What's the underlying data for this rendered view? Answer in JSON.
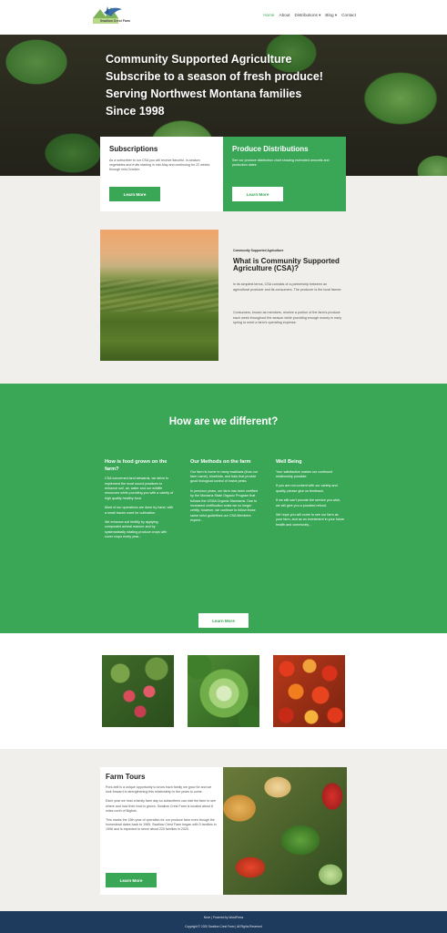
{
  "header": {
    "logo_text": "Swallow Crest Farm",
    "nav": [
      "Home",
      "About",
      "Distributions ▾",
      "Blog ▾",
      "Contact"
    ]
  },
  "hero": {
    "lines": [
      "Community Supported Agriculture",
      "Subscribe to a season of fresh produce!",
      "Serving Northwest Montana families",
      "Since 1998"
    ]
  },
  "cards": {
    "subscriptions": {
      "title": "Subscriptions",
      "text": "As a subscriber to our CSA you will receive flavorful, in-season vegetables and fruits starting in mid-May and continuing for 22 weeks through mid-October.",
      "button": "Learn More"
    },
    "distributions": {
      "title": "Produce Distributions",
      "text": "See our produce distribution chart showing estimated amounts and production dates",
      "button": "Learn More"
    }
  },
  "csa": {
    "small_label": "Community Supported Agriculture",
    "title": "What is Community Supported Agriculture (CSA)?",
    "p1": "In its simplest terms, CSA consists of a partnership between an agricultural producer and its consumers. The producer is the local farmer.",
    "p2": "Consumers, known as members, receive a portion of the farm's produce each week throughout the season while providing enough money in early spring to meet a farm's operating expense."
  },
  "different": {
    "title": "How are we different?",
    "col1": {
      "title": "How is food grown on the farm?",
      "p1": "CSA concerned land stewards, we strive to implement the most sound practices to enhance soil, air, water and our wildlife resources while providing you with a variety of high quality healthy food.",
      "p2": "Most of our operations are done by hand, with a small tractor used for cultivation.",
      "p3": "We enhance soil fertility by applying composted animal manure and by systematically rotating produce crops with cover crops every year..."
    },
    "col2": {
      "title": "Our Methods on the farm",
      "p1": "Our farm is home to many swallows (thus our farm name), bluebirds, and bats that provide good biological control of insect pests.",
      "p2": "In previous years, our farm has been certified by the Montana State Organic Program that follows the USDA Organic Standards. Due to increased certification costs we no longer certify, however, we continue to follow those same strict guidelines our CSA Members expect..."
    },
    "col3": {
      "title": "Well Being",
      "p1": "Your satisfaction makes our continued relationship possible.",
      "p2": "If you are not content with our variety and quality, please give us feedback.",
      "p3": "If we still can't provide the service you wish, we will give you a prorated refund.",
      "p4": "We hope you will come to see our farm as your farm, and as an investment in your future health and community..."
    },
    "button": "Learn More"
  },
  "tours": {
    "title": "Farm Tours",
    "p1": "Pork-belt is a unique opportunity to know each family we grow for and we look forward to strengthening this relationship in the years to come.",
    "p2": "Each year we host a family farm day so subscribers can visit the farm to see where and how their food is grown. Swallow Crest Farm is located about 6 miles north of Bigfork.",
    "p3": "This marks the 15th year of operation for our produce farm even though the homestead dates back to 1985. Swallow Crest Farm began with 5 families in 1998 and is expected to serve about 220 families in 2020.",
    "button": "Learn More"
  },
  "footer": {
    "line1": "Neve | Powered by WordPress",
    "line2": "Copyright © 2020 Swallow Crest Farm | All Rights Reserved"
  }
}
